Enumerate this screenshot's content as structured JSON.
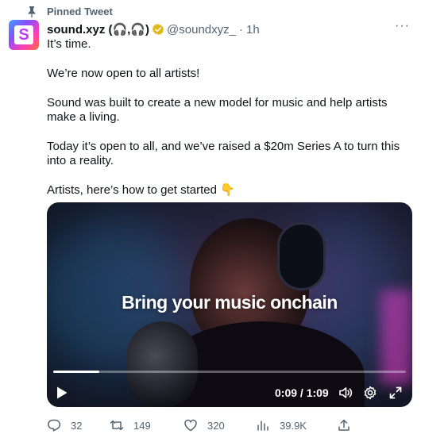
{
  "pinned": {
    "label": "Pinned Tweet"
  },
  "author": {
    "display_name": "sound.xyz (🎧,🎧)",
    "handle": "@soundxyz_",
    "separator": "·",
    "time": "1h",
    "avatar_letter": "S"
  },
  "more_label": "···",
  "tweet": {
    "paragraphs": [
      "It’s time.",
      "We’re now open to all artists!",
      "Sound was built to create a new model for music and help artists make a living.",
      "Today it’s open to all, and we’ve raised a $20m Series A to turn this into a reality.",
      "Artists, here’s how to get started 👇"
    ]
  },
  "video": {
    "caption": "Bring your music onchain",
    "current_time": "0:09",
    "duration": "1:09",
    "timecode": "0:09 / 1:09",
    "progress_fraction": 0.13
  },
  "actions": {
    "reply_count": "32",
    "retweet_count": "149",
    "like_count": "320",
    "view_count": "39.9K"
  },
  "icons": {
    "pin": "pin-icon",
    "verified": "verified-badge-icon",
    "play": "play-icon",
    "volume": "volume-icon",
    "settings": "settings-gear-icon",
    "fullscreen": "fullscreen-icon",
    "reply": "reply-icon",
    "retweet": "retweet-icon",
    "like": "heart-icon",
    "views": "analytics-icon",
    "share": "share-icon"
  },
  "colors": {
    "secondary_text": "#536471",
    "verified": "#e2b719",
    "text": "#0f1419"
  }
}
